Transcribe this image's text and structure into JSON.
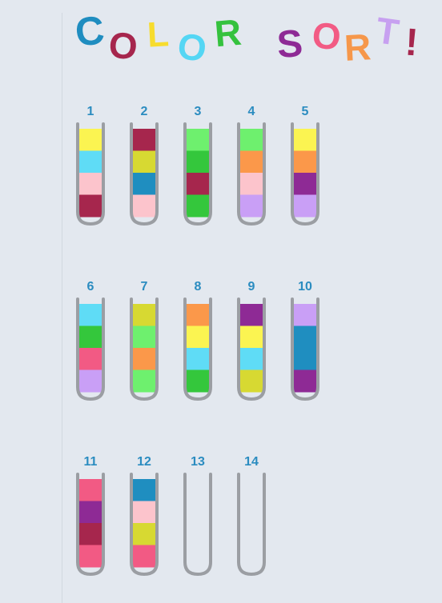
{
  "title": {
    "letters": [
      {
        "ch": "C",
        "color": "#1f8dc0"
      },
      {
        "ch": "O",
        "color": "#a6264d"
      },
      {
        "ch": "L",
        "color": "#f7dc2e"
      },
      {
        "ch": "O",
        "color": "#54d6f4"
      },
      {
        "ch": "R",
        "color": "#35c23e"
      },
      {
        "ch": "S",
        "color": "#8e2a95"
      },
      {
        "ch": "O",
        "color": "#f25b84"
      },
      {
        "ch": "R",
        "color": "#f6974a"
      },
      {
        "ch": "T",
        "color": "#c7a0f0"
      },
      {
        "ch": "!",
        "color": "#a6264d"
      }
    ]
  },
  "palette": {
    "yellow": "#fbf451",
    "cyan": "#5fdcf6",
    "pink": "#fcc4cc",
    "maroon": "#a6264d",
    "olive": "#d7d932",
    "blue": "#1f8ec0",
    "lightgreen": "#6ef06e",
    "green": "#34c73c",
    "orange": "#fb984a",
    "lavender": "#c99ff6",
    "purple": "#8e2a95",
    "rose": "#f25a84"
  },
  "tubes": [
    {
      "label": "1",
      "colors": [
        "yellow",
        "cyan",
        "pink",
        "maroon"
      ]
    },
    {
      "label": "2",
      "colors": [
        "maroon",
        "olive",
        "blue",
        "pink"
      ]
    },
    {
      "label": "3",
      "colors": [
        "lightgreen",
        "green",
        "maroon",
        "green"
      ]
    },
    {
      "label": "4",
      "colors": [
        "lightgreen",
        "orange",
        "pink",
        "lavender"
      ]
    },
    {
      "label": "5",
      "colors": [
        "yellow",
        "orange",
        "purple",
        "lavender"
      ]
    },
    {
      "label": "6",
      "colors": [
        "cyan",
        "green",
        "rose",
        "lavender"
      ]
    },
    {
      "label": "7",
      "colors": [
        "olive",
        "lightgreen",
        "orange",
        "lightgreen"
      ]
    },
    {
      "label": "8",
      "colors": [
        "orange",
        "yellow",
        "cyan",
        "green"
      ]
    },
    {
      "label": "9",
      "colors": [
        "purple",
        "yellow",
        "cyan",
        "olive"
      ]
    },
    {
      "label": "10",
      "colors": [
        "lavender",
        "blue",
        "blue",
        "purple"
      ]
    },
    {
      "label": "11",
      "colors": [
        "rose",
        "purple",
        "maroon",
        "rose"
      ]
    },
    {
      "label": "12",
      "colors": [
        "blue",
        "pink",
        "olive",
        "rose"
      ]
    },
    {
      "label": "13",
      "colors": []
    },
    {
      "label": "14",
      "colors": []
    }
  ]
}
